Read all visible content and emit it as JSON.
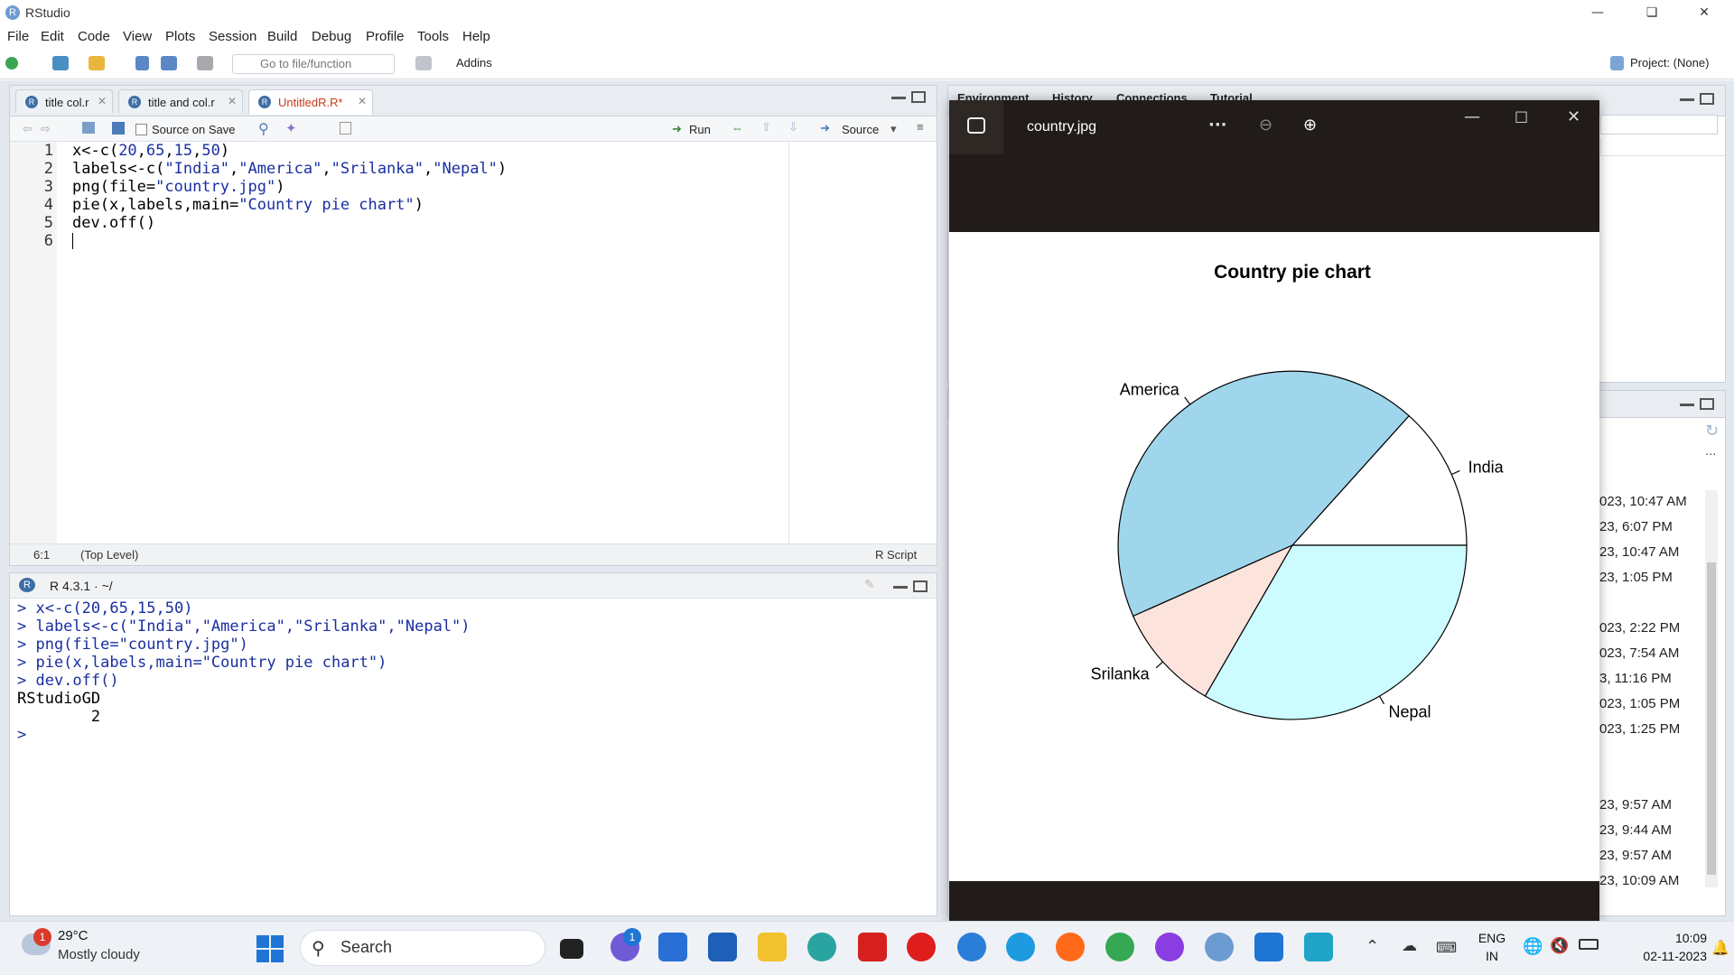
{
  "app": {
    "title": "RStudio"
  },
  "menu": [
    "File",
    "Edit",
    "Code",
    "View",
    "Plots",
    "Session",
    "Build",
    "Debug",
    "Profile",
    "Tools",
    "Help"
  ],
  "toolbar": {
    "goto_placeholder": "Go to file/function",
    "addins": "Addins",
    "project": "Project: (None)"
  },
  "editor": {
    "tabs": [
      {
        "label": "title col.r"
      },
      {
        "label": "title and col.r"
      },
      {
        "label": "UntitledR.R*"
      }
    ],
    "source_on_save": "Source on Save",
    "run": "Run",
    "source": "Source",
    "lines": [
      {
        "n": "1",
        "text": "x<-c(20,65,15,50)"
      },
      {
        "n": "2",
        "text": "labels<-c(\"India\",\"America\",\"Srilanka\",\"Nepal\")"
      },
      {
        "n": "3",
        "text": "png(file=\"country.jpg\")"
      },
      {
        "n": "4",
        "text": "pie(x,labels,main=\"Country pie chart\")"
      },
      {
        "n": "5",
        "text": "dev.off()"
      },
      {
        "n": "6",
        "text": ""
      }
    ],
    "status_pos": "6:1",
    "status_scope": "(Top Level)",
    "status_lang": "R Script"
  },
  "console": {
    "header": "R 4.3.1 · ~/",
    "lines": [
      {
        "text": "> x<-c(20,65,15,50)",
        "kind": "in"
      },
      {
        "text": "> labels<-c(\"India\",\"America\",\"Srilanka\",\"Nepal\")",
        "kind": "in"
      },
      {
        "text": "> png(file=\"country.jpg\")",
        "kind": "in"
      },
      {
        "text": "> pie(x,labels,main=\"Country pie chart\")",
        "kind": "in"
      },
      {
        "text": "> dev.off()",
        "kind": "in"
      },
      {
        "text": "RStudioGD",
        "kind": "out"
      },
      {
        "text": "        2",
        "kind": "out"
      },
      {
        "text": ">",
        "kind": "in"
      }
    ]
  },
  "env_tabs": [
    "Environment",
    "History",
    "Connections",
    "Tutorial"
  ],
  "viewer": {
    "filename": "country.jpg"
  },
  "chart_data": {
    "type": "pie",
    "title": "Country pie chart",
    "categories": [
      "India",
      "America",
      "Srilanka",
      "Nepal"
    ],
    "values": [
      20,
      65,
      15,
      50
    ],
    "colors": [
      "#ffffff",
      "#9fd6eb",
      "#fce4dc",
      "#ccfcff"
    ]
  },
  "file_times": [
    "023, 10:47 AM",
    "23, 6:07 PM",
    "23, 10:47 AM",
    "23, 1:05 PM",
    "023, 2:22 PM",
    "023, 7:54 AM",
    "3, 11:16 PM",
    "023, 1:05 PM",
    "023, 1:25 PM",
    "23, 9:57 AM",
    "23, 9:44 AM",
    "23, 9:57 AM",
    "23, 10:09 AM"
  ],
  "taskbar": {
    "weather_temp": "29°C",
    "weather_desc": "Mostly cloudy",
    "weather_badge": "1",
    "search": "Search",
    "chat_badge": "1",
    "lang": "ENG",
    "region": "IN",
    "time": "10:09",
    "date": "02-11-2023"
  }
}
